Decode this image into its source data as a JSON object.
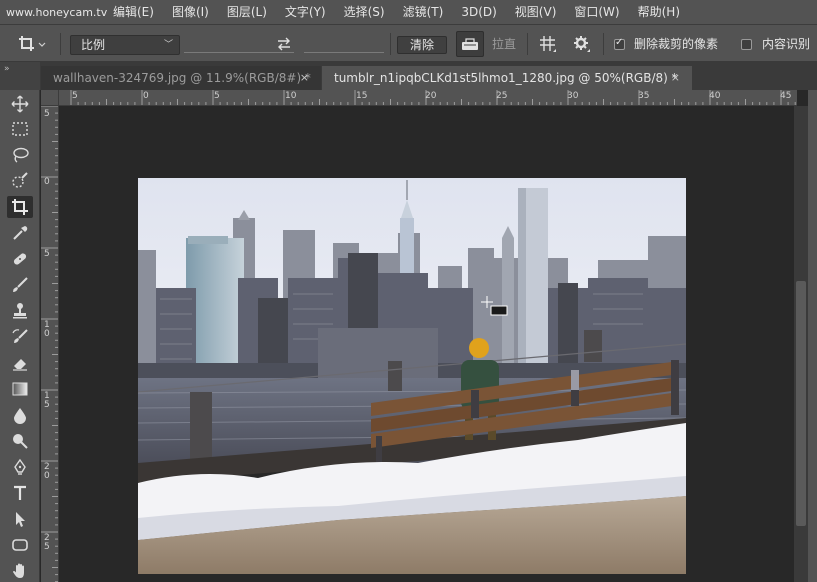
{
  "watermark": "www.honeycam.tv",
  "menu": [
    "编辑(E)",
    "图像(I)",
    "图层(L)",
    "文字(Y)",
    "选择(S)",
    "滤镜(T)",
    "3D(D)",
    "视图(V)",
    "窗口(W)",
    "帮助(H)"
  ],
  "options": {
    "ratio_select": "比例",
    "clear_button": "清除",
    "straighten_label": "拉直",
    "delete_cropped_label": "删除裁剪的像素",
    "delete_cropped_checked": true,
    "content_aware_label": "内容识别",
    "content_aware_checked": false
  },
  "panel_collapse": "»",
  "tabs": [
    {
      "label": "wallhaven-324769.jpg @ 11.9%(RGB/8#) *",
      "close": "×",
      "active": false
    },
    {
      "label": "tumblr_n1ipqbCLKd1st5lhmo1_1280.jpg @ 50%(RGB/8) *",
      "close": "×",
      "active": true
    }
  ],
  "ruler_top_ticks": [
    "5",
    "0",
    "5",
    "10",
    "15",
    "20",
    "25",
    "30",
    "35",
    "40",
    "45"
  ],
  "ruler_left_ticks": [
    "5",
    "0",
    "5",
    "1\n0",
    "1\n5",
    "2\n0",
    "2\n5"
  ],
  "tools": [
    "move-icon",
    "marquee-icon",
    "lasso-icon",
    "quick-select-icon",
    "crop-icon",
    "eyedropper-icon",
    "healing-icon",
    "brush-icon",
    "stamp-icon",
    "history-brush-icon",
    "eraser-icon",
    "gradient-icon",
    "blur-icon",
    "dodge-icon",
    "pen-icon",
    "type-icon",
    "path-select-icon",
    "shape-icon",
    "hand-icon"
  ],
  "active_tool": "crop-icon",
  "colors": {
    "menubar": "#535353",
    "canvas_bg": "#282828",
    "bench_wood": "#7a5436",
    "hat": "#e0a21c"
  }
}
